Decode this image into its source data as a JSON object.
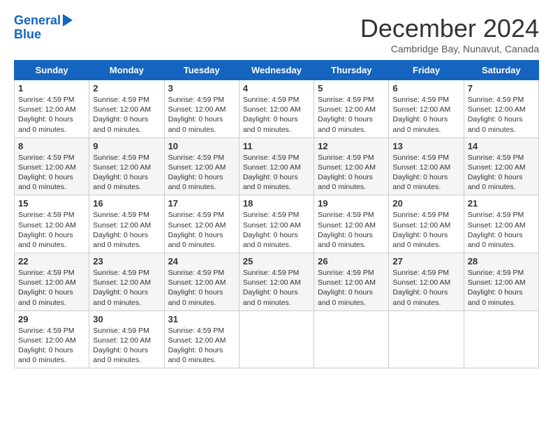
{
  "logo": {
    "line1": "General",
    "line2": "Blue"
  },
  "title": "December 2024",
  "subtitle": "Cambridge Bay, Nunavut, Canada",
  "days_header": [
    "Sunday",
    "Monday",
    "Tuesday",
    "Wednesday",
    "Thursday",
    "Friday",
    "Saturday"
  ],
  "cell_template": {
    "sunrise": "Sunrise: 4:59 PM",
    "sunset": "Sunset: 12:00 AM",
    "daylight": "Daylight: 0 hours and 0 minutes."
  },
  "weeks": [
    [
      {
        "day": "1",
        "sunrise": "Sunrise: 4:59 PM",
        "sunset": "Sunset: 12:00 AM",
        "daylight": "Daylight: 0 hours and 0 minutes."
      },
      {
        "day": "2",
        "sunrise": "Sunrise: 4:59 PM",
        "sunset": "Sunset: 12:00 AM",
        "daylight": "Daylight: 0 hours and 0 minutes."
      },
      {
        "day": "3",
        "sunrise": "Sunrise: 4:59 PM",
        "sunset": "Sunset: 12:00 AM",
        "daylight": "Daylight: 0 hours and 0 minutes."
      },
      {
        "day": "4",
        "sunrise": "Sunrise: 4:59 PM",
        "sunset": "Sunset: 12:00 AM",
        "daylight": "Daylight: 0 hours and 0 minutes."
      },
      {
        "day": "5",
        "sunrise": "Sunrise: 4:59 PM",
        "sunset": "Sunset: 12:00 AM",
        "daylight": "Daylight: 0 hours and 0 minutes."
      },
      {
        "day": "6",
        "sunrise": "Sunrise: 4:59 PM",
        "sunset": "Sunset: 12:00 AM",
        "daylight": "Daylight: 0 hours and 0 minutes."
      },
      {
        "day": "7",
        "sunrise": "Sunrise: 4:59 PM",
        "sunset": "Sunset: 12:00 AM",
        "daylight": "Daylight: 0 hours and 0 minutes."
      }
    ],
    [
      {
        "day": "8",
        "sunrise": "Sunrise: 4:59 PM",
        "sunset": "Sunset: 12:00 AM",
        "daylight": "Daylight: 0 hours and 0 minutes."
      },
      {
        "day": "9",
        "sunrise": "Sunrise: 4:59 PM",
        "sunset": "Sunset: 12:00 AM",
        "daylight": "Daylight: 0 hours and 0 minutes."
      },
      {
        "day": "10",
        "sunrise": "Sunrise: 4:59 PM",
        "sunset": "Sunset: 12:00 AM",
        "daylight": "Daylight: 0 hours and 0 minutes."
      },
      {
        "day": "11",
        "sunrise": "Sunrise: 4:59 PM",
        "sunset": "Sunset: 12:00 AM",
        "daylight": "Daylight: 0 hours and 0 minutes."
      },
      {
        "day": "12",
        "sunrise": "Sunrise: 4:59 PM",
        "sunset": "Sunset: 12:00 AM",
        "daylight": "Daylight: 0 hours and 0 minutes."
      },
      {
        "day": "13",
        "sunrise": "Sunrise: 4:59 PM",
        "sunset": "Sunset: 12:00 AM",
        "daylight": "Daylight: 0 hours and 0 minutes."
      },
      {
        "day": "14",
        "sunrise": "Sunrise: 4:59 PM",
        "sunset": "Sunset: 12:00 AM",
        "daylight": "Daylight: 0 hours and 0 minutes."
      }
    ],
    [
      {
        "day": "15",
        "sunrise": "Sunrise: 4:59 PM",
        "sunset": "Sunset: 12:00 AM",
        "daylight": "Daylight: 0 hours and 0 minutes."
      },
      {
        "day": "16",
        "sunrise": "Sunrise: 4:59 PM",
        "sunset": "Sunset: 12:00 AM",
        "daylight": "Daylight: 0 hours and 0 minutes."
      },
      {
        "day": "17",
        "sunrise": "Sunrise: 4:59 PM",
        "sunset": "Sunset: 12:00 AM",
        "daylight": "Daylight: 0 hours and 0 minutes."
      },
      {
        "day": "18",
        "sunrise": "Sunrise: 4:59 PM",
        "sunset": "Sunset: 12:00 AM",
        "daylight": "Daylight: 0 hours and 0 minutes."
      },
      {
        "day": "19",
        "sunrise": "Sunrise: 4:59 PM",
        "sunset": "Sunset: 12:00 AM",
        "daylight": "Daylight: 0 hours and 0 minutes."
      },
      {
        "day": "20",
        "sunrise": "Sunrise: 4:59 PM",
        "sunset": "Sunset: 12:00 AM",
        "daylight": "Daylight: 0 hours and 0 minutes."
      },
      {
        "day": "21",
        "sunrise": "Sunrise: 4:59 PM",
        "sunset": "Sunset: 12:00 AM",
        "daylight": "Daylight: 0 hours and 0 minutes."
      }
    ],
    [
      {
        "day": "22",
        "sunrise": "Sunrise: 4:59 PM",
        "sunset": "Sunset: 12:00 AM",
        "daylight": "Daylight: 0 hours and 0 minutes."
      },
      {
        "day": "23",
        "sunrise": "Sunrise: 4:59 PM",
        "sunset": "Sunset: 12:00 AM",
        "daylight": "Daylight: 0 hours and 0 minutes."
      },
      {
        "day": "24",
        "sunrise": "Sunrise: 4:59 PM",
        "sunset": "Sunset: 12:00 AM",
        "daylight": "Daylight: 0 hours and 0 minutes."
      },
      {
        "day": "25",
        "sunrise": "Sunrise: 4:59 PM",
        "sunset": "Sunset: 12:00 AM",
        "daylight": "Daylight: 0 hours and 0 minutes."
      },
      {
        "day": "26",
        "sunrise": "Sunrise: 4:59 PM",
        "sunset": "Sunset: 12:00 AM",
        "daylight": "Daylight: 0 hours and 0 minutes."
      },
      {
        "day": "27",
        "sunrise": "Sunrise: 4:59 PM",
        "sunset": "Sunset: 12:00 AM",
        "daylight": "Daylight: 0 hours and 0 minutes."
      },
      {
        "day": "28",
        "sunrise": "Sunrise: 4:59 PM",
        "sunset": "Sunset: 12:00 AM",
        "daylight": "Daylight: 0 hours and 0 minutes."
      }
    ],
    [
      {
        "day": "29",
        "sunrise": "Sunrise: 4:59 PM",
        "sunset": "Sunset: 12:00 AM",
        "daylight": "Daylight: 0 hours and 0 minutes."
      },
      {
        "day": "30",
        "sunrise": "Sunrise: 4:59 PM",
        "sunset": "Sunset: 12:00 AM",
        "daylight": "Daylight: 0 hours and 0 minutes."
      },
      {
        "day": "31",
        "sunrise": "Sunrise: 4:59 PM",
        "sunset": "Sunset: 12:00 AM",
        "daylight": "Daylight: 0 hours and 0 minutes."
      },
      null,
      null,
      null,
      null
    ]
  ]
}
